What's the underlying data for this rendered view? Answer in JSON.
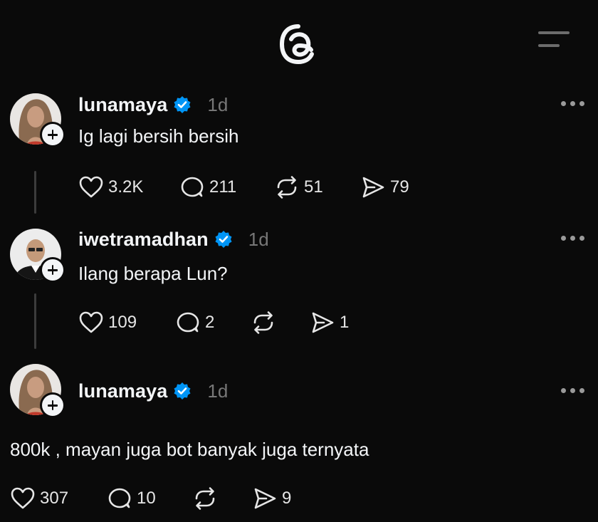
{
  "app": {
    "logo_icon": "threads-logo-icon",
    "menu_icon": "hamburger-menu-icon"
  },
  "colors": {
    "background": "#0a0a0a",
    "text": "#f3f5f7",
    "muted": "#777777",
    "verified": "#0095f6",
    "thread_line": "#3c3c3c"
  },
  "posts": [
    {
      "username": "lunamaya",
      "verified": true,
      "time": "1d",
      "text": "Ig lagi bersih bersih",
      "likes": "3.2K",
      "replies": "211",
      "reposts": "51",
      "shares": "79"
    },
    {
      "username": "iwetramadhan",
      "verified": true,
      "time": "1d",
      "text": "Ilang berapa Lun?",
      "likes": "109",
      "replies": "2",
      "reposts": "",
      "shares": "1"
    },
    {
      "username": "lunamaya",
      "verified": true,
      "time": "1d",
      "text": "800k , mayan juga bot banyak juga ternyata",
      "likes": "307",
      "replies": "10",
      "reposts": "",
      "shares": "9"
    }
  ]
}
